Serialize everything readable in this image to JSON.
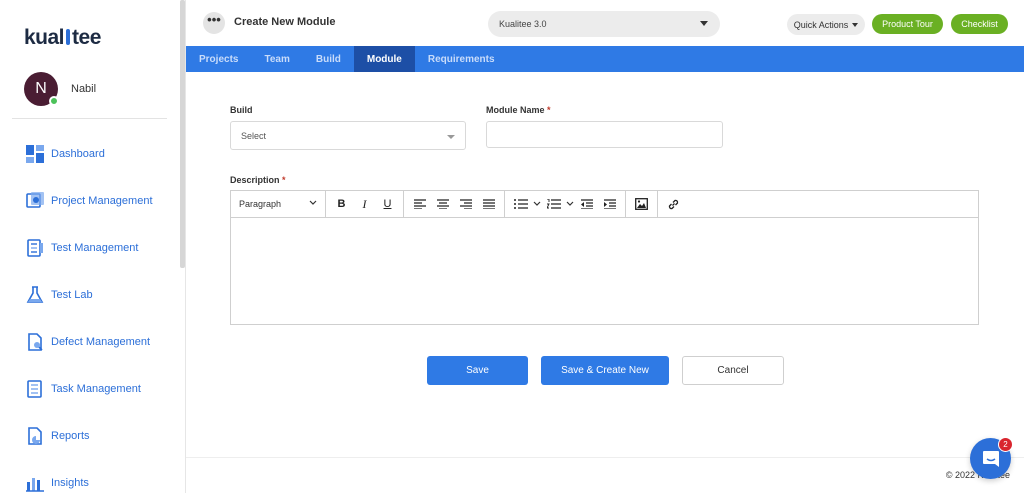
{
  "app": {
    "logo_left": "kual",
    "logo_right": "tee",
    "brand_color": "#2c6fd8"
  },
  "user": {
    "initial": "N",
    "name": "Nabil",
    "status": "online"
  },
  "sidebar": {
    "items": [
      {
        "label": "Dashboard",
        "icon": "dashboard-icon"
      },
      {
        "label": "Project Management",
        "icon": "project-management-icon"
      },
      {
        "label": "Test Management",
        "icon": "test-management-icon"
      },
      {
        "label": "Test Lab",
        "icon": "flask-icon"
      },
      {
        "label": "Defect Management",
        "icon": "defect-icon"
      },
      {
        "label": "Task Management",
        "icon": "task-icon"
      },
      {
        "label": "Reports",
        "icon": "reports-icon"
      },
      {
        "label": "Insights",
        "icon": "insights-icon"
      }
    ]
  },
  "header": {
    "menu_glyph": "•••",
    "title": "Create New Module",
    "project": "Kualitee 3.0",
    "quick_actions": "Quick Actions",
    "product_tour": "Product Tour",
    "checklist": "Checklist"
  },
  "tabs": [
    {
      "label": "Projects",
      "active": false
    },
    {
      "label": "Team",
      "active": false
    },
    {
      "label": "Build",
      "active": false
    },
    {
      "label": "Module",
      "active": true
    },
    {
      "label": "Requirements",
      "active": false
    }
  ],
  "form": {
    "build_label": "Build",
    "build_value": "Select",
    "module_name_label": "Module Name",
    "module_name_value": "",
    "description_label": "Description",
    "required_mark": "*",
    "paragraph_format": "Paragraph",
    "bold_glyph": "B",
    "italic_glyph": "I",
    "underline_glyph": "U"
  },
  "actions": {
    "save": "Save",
    "save_create_new": "Save & Create New",
    "cancel": "Cancel"
  },
  "footer": {
    "copyright": "© 2022 Kualitee"
  },
  "chat": {
    "badge_count": "2"
  }
}
